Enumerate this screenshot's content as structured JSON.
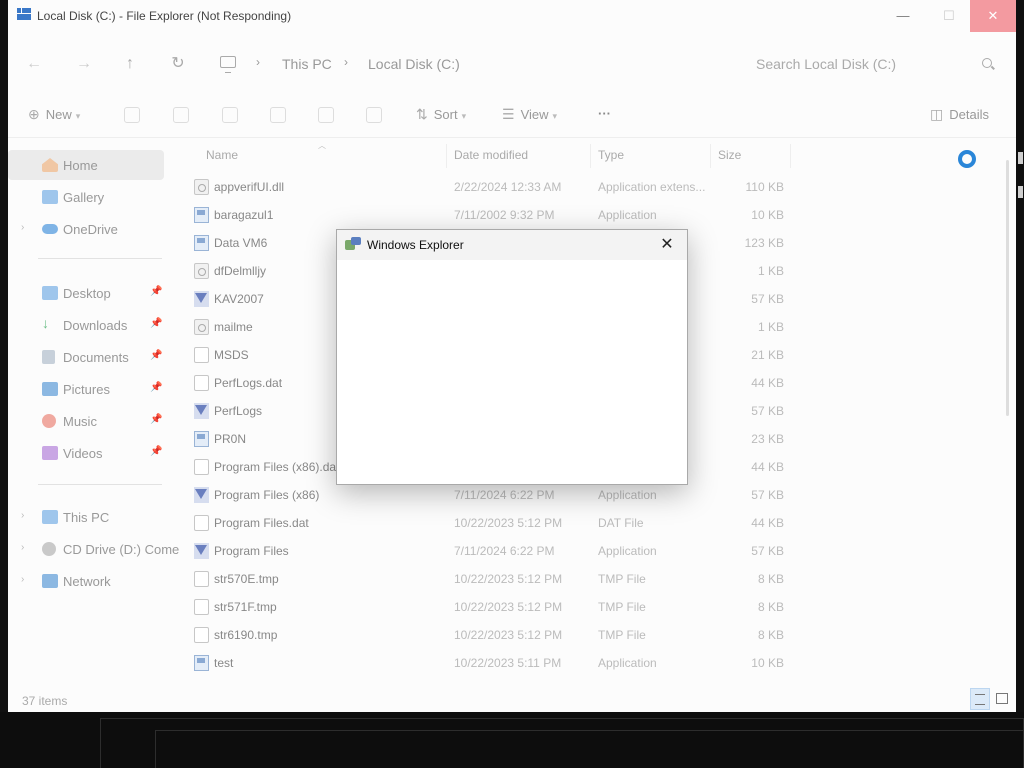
{
  "window": {
    "title": "Local Disk (C:) - File Explorer (Not Responding)"
  },
  "address": {
    "crumbs": [
      "This PC",
      "Local Disk (C:)"
    ]
  },
  "search": {
    "placeholder": "Search Local Disk (C:)"
  },
  "toolbar": {
    "new_label": "New",
    "sort_label": "Sort",
    "view_label": "View",
    "more_label": "···",
    "details_label": "Details"
  },
  "sidebar": {
    "items": [
      {
        "label": "Home",
        "icon": "home-icon"
      },
      {
        "label": "Gallery",
        "icon": "gallery-icon"
      },
      {
        "label": "OneDrive",
        "icon": "cloud-icon"
      },
      {
        "label": "Desktop",
        "icon": "desktop-icon"
      },
      {
        "label": "Downloads",
        "icon": "download-icon"
      },
      {
        "label": "Documents",
        "icon": "documents-icon"
      },
      {
        "label": "Pictures",
        "icon": "pictures-icon"
      },
      {
        "label": "Music",
        "icon": "music-icon"
      },
      {
        "label": "Videos",
        "icon": "videos-icon"
      },
      {
        "label": "This PC",
        "icon": "pc-icon"
      },
      {
        "label": "CD Drive (D:) Come",
        "icon": "cd-drive-icon"
      },
      {
        "label": "Network",
        "icon": "network-icon"
      }
    ]
  },
  "columns": {
    "name": "Name",
    "date": "Date modified",
    "type": "Type",
    "size": "Size"
  },
  "files": [
    {
      "name": "appverifUI.dll",
      "date": "2/22/2024 12:33 AM",
      "type": "Application extens...",
      "size": "110 KB",
      "icon": "dll"
    },
    {
      "name": "baragazul1",
      "date": "7/11/2002 9:32 PM",
      "type": "Application",
      "size": "10 KB",
      "icon": "app"
    },
    {
      "name": "Data VM6",
      "date": "",
      "type": "",
      "size": "123 KB",
      "icon": "app"
    },
    {
      "name": "dfDelmlljy",
      "date": "",
      "type": "",
      "size": "1 KB",
      "icon": "dll"
    },
    {
      "name": "KAV2007",
      "date": "",
      "type": "",
      "size": "57 KB",
      "icon": "kav"
    },
    {
      "name": "mailme",
      "date": "",
      "type": "",
      "size": "1 KB",
      "icon": "dll"
    },
    {
      "name": "MSDS",
      "date": "",
      "type": "",
      "size": "21 KB",
      "icon": "doc"
    },
    {
      "name": "PerfLogs.dat",
      "date": "",
      "type": "",
      "size": "44 KB",
      "icon": "doc"
    },
    {
      "name": "PerfLogs",
      "date": "",
      "type": "",
      "size": "57 KB",
      "icon": "kav"
    },
    {
      "name": "PR0N",
      "date": "",
      "type": "",
      "size": "23 KB",
      "icon": "app"
    },
    {
      "name": "Program Files (x86).dat",
      "date": "",
      "type": "",
      "size": "44 KB",
      "icon": "doc"
    },
    {
      "name": "Program Files (x86)",
      "date": "7/11/2024 6:22 PM",
      "type": "Application",
      "size": "57 KB",
      "icon": "kav"
    },
    {
      "name": "Program Files.dat",
      "date": "10/22/2023 5:12 PM",
      "type": "DAT File",
      "size": "44 KB",
      "icon": "doc"
    },
    {
      "name": "Program Files",
      "date": "7/11/2024 6:22 PM",
      "type": "Application",
      "size": "57 KB",
      "icon": "kav"
    },
    {
      "name": "str570E.tmp",
      "date": "10/22/2023 5:12 PM",
      "type": "TMP File",
      "size": "8 KB",
      "icon": "doc"
    },
    {
      "name": "str571F.tmp",
      "date": "10/22/2023 5:12 PM",
      "type": "TMP File",
      "size": "8 KB",
      "icon": "doc"
    },
    {
      "name": "str6190.tmp",
      "date": "10/22/2023 5:12 PM",
      "type": "TMP File",
      "size": "8 KB",
      "icon": "doc"
    },
    {
      "name": "test",
      "date": "10/22/2023 5:11 PM",
      "type": "Application",
      "size": "10 KB",
      "icon": "app"
    }
  ],
  "status": {
    "count": "37 items"
  },
  "dialog": {
    "title": "Windows Explorer",
    "close_glyph": "✕"
  },
  "colors": {
    "accent": "#2a86d8",
    "close_button": "#f39aa0"
  }
}
